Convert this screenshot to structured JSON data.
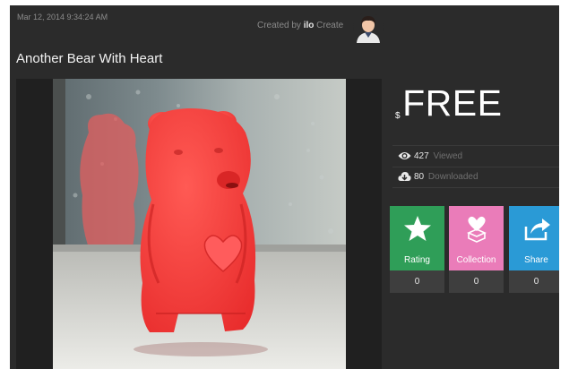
{
  "header": {
    "date": "Mar 12, 2014 9:34:24 AM",
    "created_by_prefix": "Created by ",
    "creator_name": "ilo",
    "creator_suffix": " Create"
  },
  "item": {
    "title": "Another Bear With Heart",
    "currency_symbol": "$",
    "price": "FREE"
  },
  "stats": {
    "viewed_count": "427",
    "viewed_label": "Viewed",
    "downloaded_count": "80",
    "downloaded_label": "Downloaded"
  },
  "actions": [
    {
      "label": "Rating",
      "count": "0",
      "color": "#2f9e58",
      "icon": "star-icon"
    },
    {
      "label": "Collection",
      "count": "0",
      "color": "#ea7cb9",
      "icon": "heart-box-icon"
    },
    {
      "label": "Share",
      "count": "0",
      "color": "#2a9ad6",
      "icon": "share-arrow-icon"
    }
  ],
  "colors": {
    "background": "#2b2b2b",
    "bear": "#ff3b3b"
  }
}
